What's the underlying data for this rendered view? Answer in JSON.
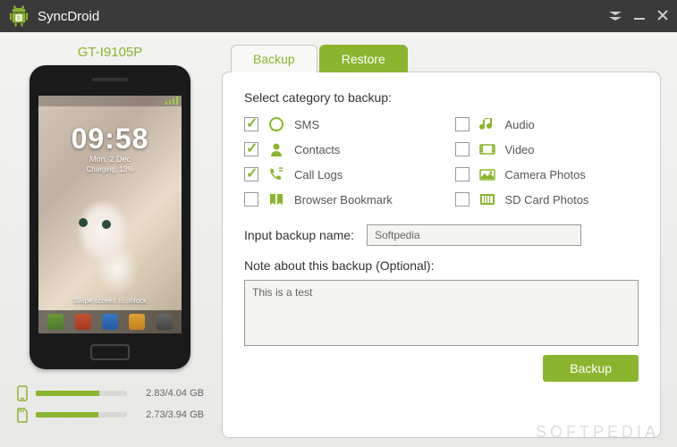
{
  "app": {
    "title": "SyncDroid"
  },
  "device": {
    "name": "GT-I9105P",
    "clock_time": "09:58",
    "clock_date": "Mon, 2 Dec",
    "charging": "Charging, 13%",
    "swipe_hint": "Swipe screen to unlock"
  },
  "storage": {
    "internal": {
      "text": "2.83/4.04 GB",
      "pct": 70
    },
    "external": {
      "text": "2.73/3.94 GB",
      "pct": 69
    }
  },
  "tabs": {
    "backup": "Backup",
    "restore": "Restore"
  },
  "panel": {
    "select_label": "Select category to backup:",
    "input_name_label": "Input backup name:",
    "input_name_value": "Softpedia",
    "note_label": "Note about this backup (Optional):",
    "note_value": "This is a test",
    "backup_button": "Backup"
  },
  "categories": [
    {
      "label": "SMS",
      "checked": true,
      "icon": "sms"
    },
    {
      "label": "Audio",
      "checked": false,
      "icon": "audio"
    },
    {
      "label": "Contacts",
      "checked": true,
      "icon": "contacts"
    },
    {
      "label": "Video",
      "checked": false,
      "icon": "video"
    },
    {
      "label": "Call Logs",
      "checked": true,
      "icon": "calllogs"
    },
    {
      "label": "Camera Photos",
      "checked": false,
      "icon": "camera"
    },
    {
      "label": "Browser Bookmark",
      "checked": false,
      "icon": "bookmark"
    },
    {
      "label": "SD Card Photos",
      "checked": false,
      "icon": "sdcard"
    }
  ],
  "watermark": "SOFTPEDIA"
}
